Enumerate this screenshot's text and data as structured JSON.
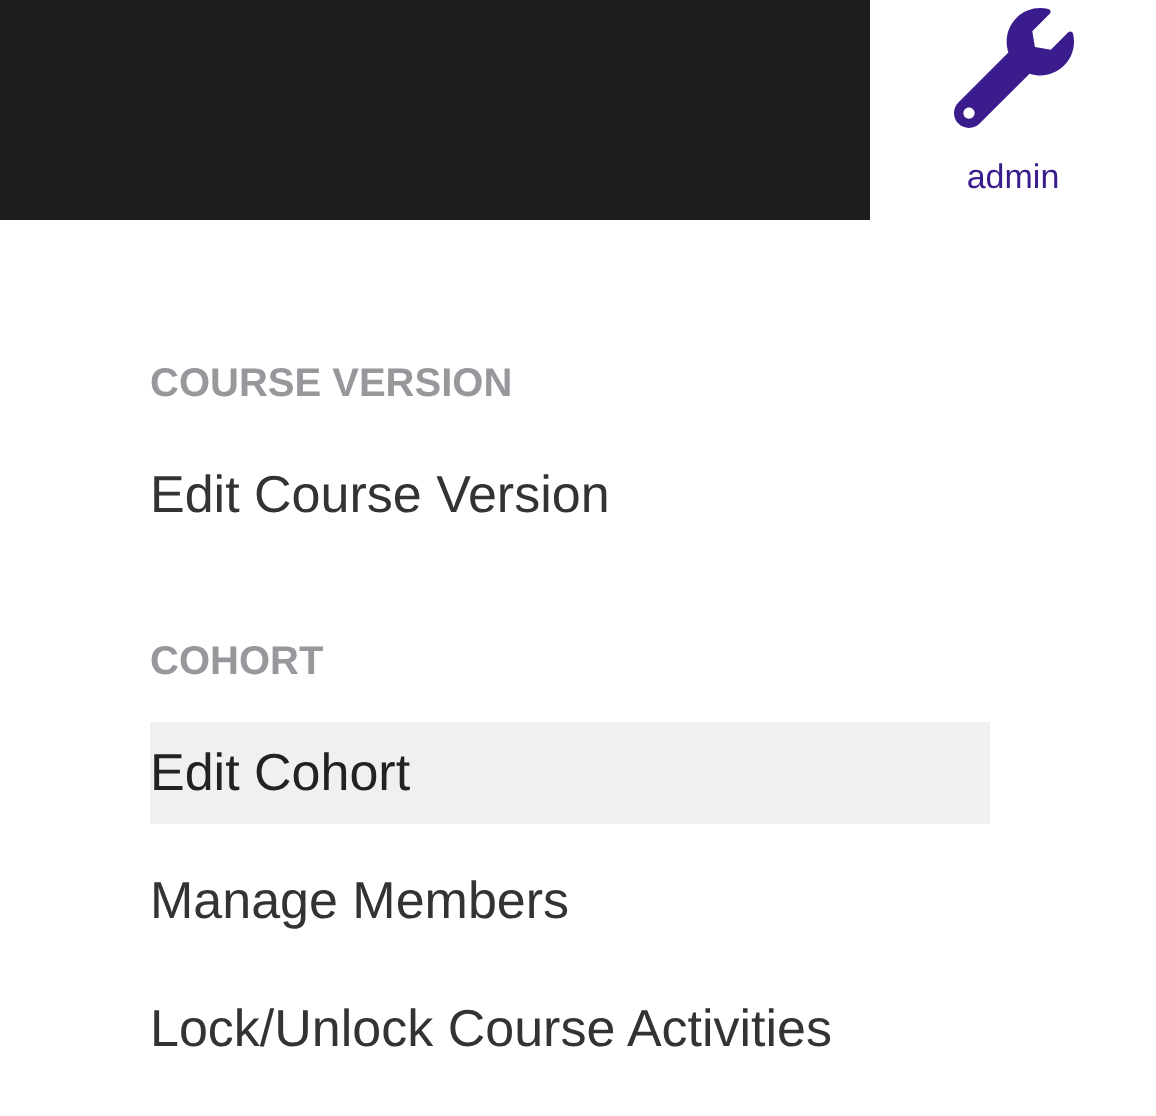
{
  "header": {
    "user_label": "admin"
  },
  "sections": [
    {
      "heading": "COURSE VERSION",
      "items": [
        {
          "label": "Edit Course Version",
          "selected": false
        }
      ]
    },
    {
      "heading": "COHORT",
      "items": [
        {
          "label": "Edit Cohort",
          "selected": true
        },
        {
          "label": "Manage Members",
          "selected": false
        },
        {
          "label": "Lock/Unlock Course Activities",
          "selected": false
        }
      ]
    }
  ]
}
